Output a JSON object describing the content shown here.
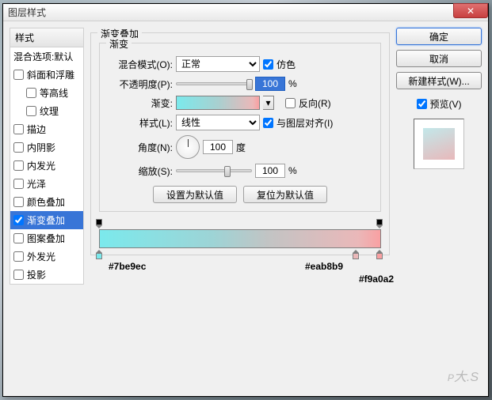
{
  "window": {
    "title": "图层样式",
    "close": "✕"
  },
  "sidebar": {
    "header": "样式",
    "items": [
      {
        "label": "混合选项:默认",
        "checked": false,
        "noCheckbox": true
      },
      {
        "label": "斜面和浮雕",
        "checked": false
      },
      {
        "label": "等高线",
        "checked": false,
        "sub": true
      },
      {
        "label": "纹理",
        "checked": false,
        "sub": true
      },
      {
        "label": "描边",
        "checked": false
      },
      {
        "label": "内阴影",
        "checked": false
      },
      {
        "label": "内发光",
        "checked": false
      },
      {
        "label": "光泽",
        "checked": false
      },
      {
        "label": "颜色叠加",
        "checked": false
      },
      {
        "label": "渐变叠加",
        "checked": true,
        "selected": true
      },
      {
        "label": "图案叠加",
        "checked": false
      },
      {
        "label": "外发光",
        "checked": false
      },
      {
        "label": "投影",
        "checked": false
      }
    ]
  },
  "panel": {
    "title": "渐变叠加",
    "group": "渐变",
    "blend_label": "混合模式(O):",
    "blend_value": "正常",
    "dither": "仿色",
    "opacity_label": "不透明度(P):",
    "opacity_value": "100",
    "pct": "%",
    "gradient_label": "渐变:",
    "reverse": "反向(R)",
    "style_label": "样式(L):",
    "style_value": "线性",
    "align": "与图层对齐(I)",
    "angle_label": "角度(N):",
    "angle_value": "100",
    "deg": "度",
    "scale_label": "缩放(S):",
    "scale_value": "100",
    "defaults_btn": "设置为默认值",
    "reset_btn": "复位为默认值"
  },
  "gradient_stops": {
    "c1": "#7be9ec",
    "c2": "#eab8b9",
    "c3": "#f9a0a2"
  },
  "right": {
    "ok": "确定",
    "cancel": "取消",
    "new_style": "新建样式(W)...",
    "preview": "预览(V)"
  },
  "watermark": {
    "big": "P",
    "small": "大.S"
  }
}
